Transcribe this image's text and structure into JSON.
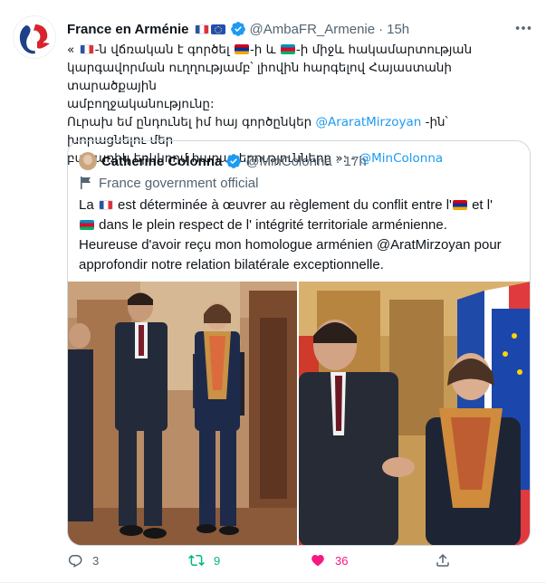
{
  "author": {
    "name": "France en Arménie",
    "handle": "@AmbaFR_Armenie",
    "separator": "·",
    "time": "15h"
  },
  "tweet": {
    "line1_a": "« ",
    "line1_b": "-ն վճռական է գործել ",
    "line1_c": "-ի և ",
    "line1_d": "-ի միջև հակամարտության",
    "line2": "կարգավորման ուղղությամբ՝ լիովին հարգելով Հայաստանի տարածքային",
    "line3": "ամբողջականությունը:",
    "line4_a": "Ուրախ եմ ընդունել իմ հայ գործընկեր ",
    "line4_mention": "@AraratMirzoyan",
    "line4_b": " -ին՝ խորացնելու մեր",
    "line5_a": "բացառիկ երկկողմ հարաբերությունները »: - ",
    "line5_mention": "@MinColonna"
  },
  "quote": {
    "name": "Catherine Colonna",
    "handle": "@MinColonna",
    "separator": "·",
    "time": "17h",
    "label": "France government official",
    "text_a": "La ",
    "text_b": " est déterminée à œuvrer au règlement du conflit entre l'",
    "text_c": " et l'",
    "text_d": " dans le plein respect de l' intégrité territoriale arménienne.",
    "text_e": "Heureuse d'avoir reçu mon homologue arménien  @AratMirzoyan pour approfondir notre relation bilatérale exceptionnelle."
  },
  "actions": {
    "replies": "3",
    "retweets": "9",
    "likes": "36"
  },
  "colors": {
    "link": "#1d9bf0",
    "retweet": "#00ba7c",
    "like": "#f91880",
    "muted": "#536471"
  },
  "icons": [
    "more-icon",
    "verified-badge-icon",
    "government-flag-icon",
    "reply-icon",
    "retweet-icon",
    "like-icon",
    "share-icon"
  ]
}
